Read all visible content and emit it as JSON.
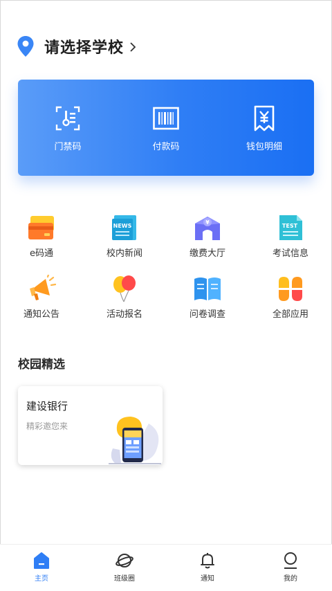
{
  "header": {
    "title": "请选择学校"
  },
  "card": {
    "items": [
      {
        "label": "门禁码",
        "icon": "access-code-icon"
      },
      {
        "label": "付款码",
        "icon": "barcode-icon"
      },
      {
        "label": "钱包明细",
        "icon": "wallet-receipt-icon"
      }
    ]
  },
  "grid": {
    "items": [
      {
        "label": "e码通"
      },
      {
        "label": "校内新闻",
        "badge": "NEWS"
      },
      {
        "label": "缴费大厅",
        "badge": "¥"
      },
      {
        "label": "考试信息",
        "badge": "TEST"
      },
      {
        "label": "通知公告"
      },
      {
        "label": "活动报名"
      },
      {
        "label": "问卷调查"
      },
      {
        "label": "全部应用"
      }
    ]
  },
  "section": {
    "title": "校园精选"
  },
  "promo": {
    "title": "建设银行",
    "subtitle": "精彩邀您来"
  },
  "nav": {
    "items": [
      {
        "label": "主页",
        "active": true
      },
      {
        "label": "班级圈"
      },
      {
        "label": "通知"
      },
      {
        "label": "我的"
      }
    ]
  },
  "colors": {
    "accent": "#2f7ef5"
  }
}
